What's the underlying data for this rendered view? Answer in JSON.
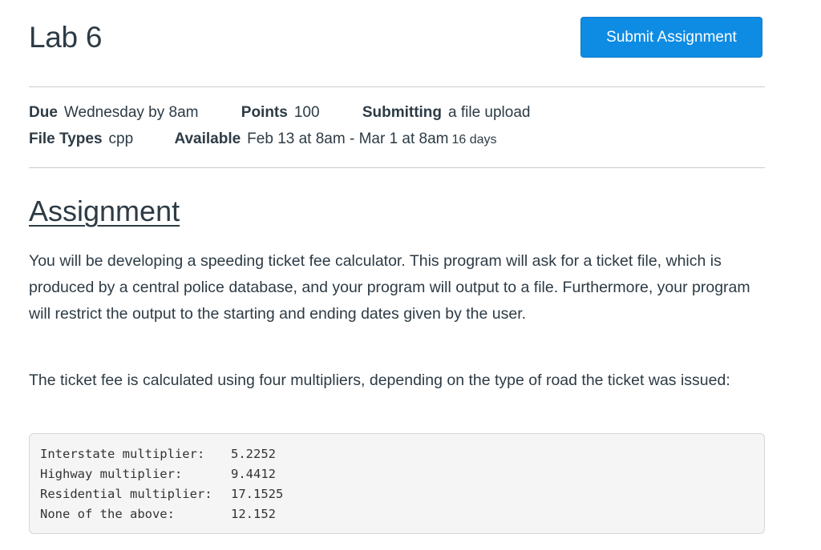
{
  "page": {
    "title": "Lab 6",
    "submit_label": "Submit Assignment",
    "accent": "#0e8ce4"
  },
  "details": {
    "due_label": "Due",
    "due_value": "Wednesday by 8am",
    "points_label": "Points",
    "points_value": "100",
    "submitting_label": "Submitting",
    "submitting_value": "a file upload",
    "file_types_label": "File Types",
    "file_types_value": "cpp",
    "available_label": "Available",
    "available_value": "Feb 13 at 8am - Mar 1 at 8am",
    "available_extra": "16 days"
  },
  "content": {
    "heading": "Assignment",
    "paragraph1": "You will be developing a speeding ticket fee calculator. This program will ask for a ticket file, which is produced by a central police database, and your program will output to a file. Furthermore, your program will restrict the output to the starting and ending dates given by the user.",
    "paragraph2": "The ticket fee is calculated using four multipliers, depending on the type of road the ticket was issued:",
    "code_lines": [
      {
        "label": "Interstate multiplier:",
        "value": "5.2252"
      },
      {
        "label": "Highway multiplier:",
        "value": "9.4412"
      },
      {
        "label": "Residential multiplier:",
        "value": "17.1525"
      },
      {
        "label": "None of the above:",
        "value": "12.152"
      }
    ]
  }
}
